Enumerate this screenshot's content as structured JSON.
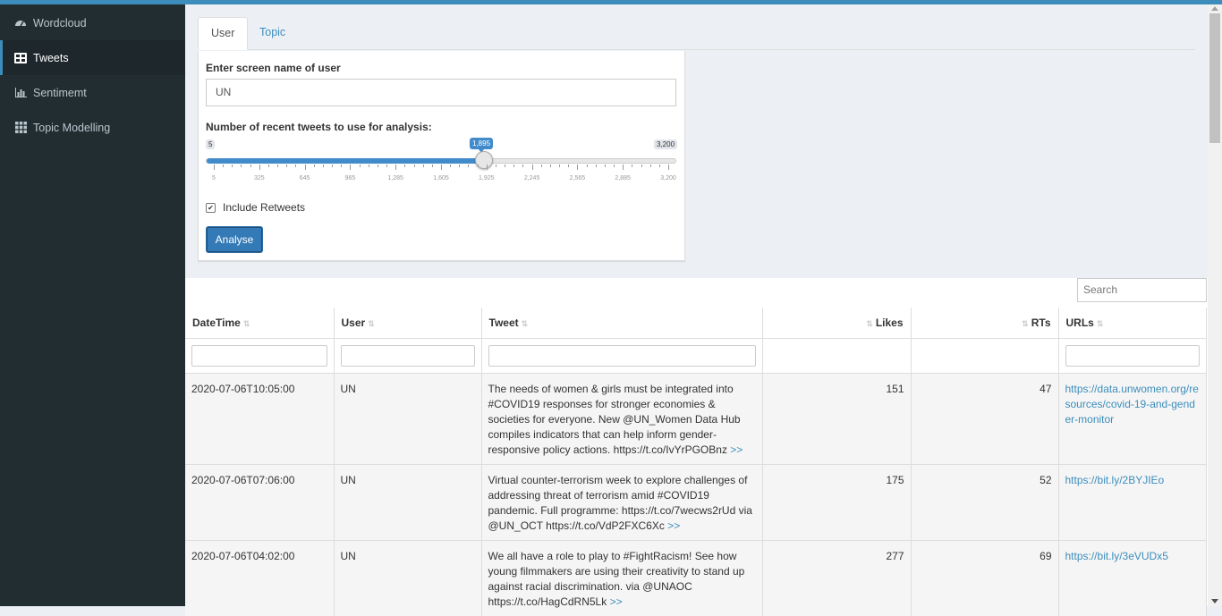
{
  "sidebar": {
    "items": [
      {
        "label": "Wordcloud",
        "icon": "dashboard-icon",
        "active": false
      },
      {
        "label": "Tweets",
        "icon": "table-icon",
        "active": true
      },
      {
        "label": "Sentimemt",
        "icon": "bar-chart-icon",
        "active": false
      },
      {
        "label": "Topic Modelling",
        "icon": "grid-icon",
        "active": false
      }
    ]
  },
  "tabs": [
    "User",
    "Topic"
  ],
  "form": {
    "screen_name_label": "Enter screen name of user",
    "screen_name_value": "UN",
    "slider_label": "Number of recent tweets to use for analysis:",
    "slider_min": "5",
    "slider_max": "3,200",
    "slider_value_label": "1,895",
    "slider_value": 1895,
    "slider_min_num": 5,
    "slider_max_num": 3200,
    "ticks": [
      "5",
      "325",
      "645",
      "965",
      "1,285",
      "1,605",
      "1,925",
      "2,245",
      "2,565",
      "2,885",
      "3,200"
    ],
    "include_retweets_label": "Include Retweets",
    "include_retweets_checked": true,
    "analyse_label": "Analyse"
  },
  "table": {
    "search_placeholder": "Search",
    "columns": [
      "DateTime",
      "User",
      "Tweet",
      "Likes",
      "RTs",
      "URLs"
    ],
    "more_label": ">>",
    "rows": [
      {
        "datetime": "2020-07-06T10:05:00",
        "user": "UN",
        "tweet": "The needs of women & girls must be integrated into #COVID19 responses for stronger economies & societies for everyone. New @UN_Women Data Hub compiles indicators that can help inform gender-responsive policy actions. https://t.co/IvYrPGOBnz",
        "likes": "151",
        "rts": "47",
        "url": "https://data.unwomen.org/resources/covid-19-and-gender-monitor"
      },
      {
        "datetime": "2020-07-06T07:06:00",
        "user": "UN",
        "tweet": "Virtual counter-terrorism week to explore challenges of addressing threat of terrorism amid #COVID19 pandemic. Full programme: https://t.co/7wecws2rUd via @UN_OCT https://t.co/VdP2FXC6Xc",
        "likes": "175",
        "rts": "52",
        "url": "https://bit.ly/2BYJIEo"
      },
      {
        "datetime": "2020-07-06T04:02:00",
        "user": "UN",
        "tweet": "We all have a role to play to #FightRacism! See how young filmmakers are using their creativity to stand up against racial discrimination. via @UNAOC https://t.co/HagCdRN5Lk",
        "likes": "277",
        "rts": "69",
        "url": "https://bit.ly/3eVUDx5"
      }
    ]
  }
}
